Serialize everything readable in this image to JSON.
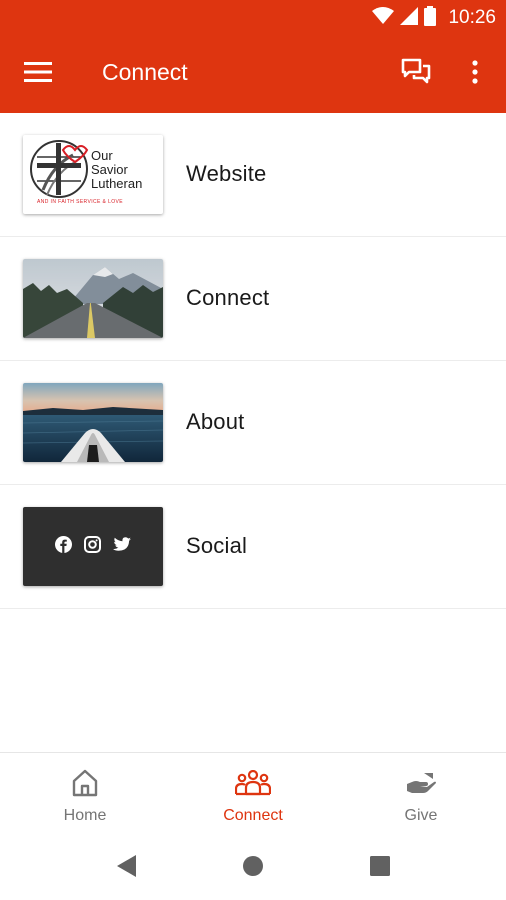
{
  "status_bar": {
    "time": "10:26"
  },
  "app_bar": {
    "title": "Connect",
    "menu_icon": "menu-icon",
    "chat_icon": "chat-icon",
    "more_icon": "more-vert-icon"
  },
  "list": {
    "items": [
      {
        "label": "Website",
        "thumb": {
          "logo_line1": "Our",
          "logo_line2": "Savior",
          "logo_line3": "Lutheran",
          "tagline": "AND IN FAITH SERVICE & LOVE"
        }
      },
      {
        "label": "Connect",
        "thumb": "mountain-road-photo"
      },
      {
        "label": "About",
        "thumb": "kayak-lake-photo"
      },
      {
        "label": "Social",
        "thumb": "social-icons-tile"
      }
    ]
  },
  "bottom_nav": {
    "tabs": [
      {
        "label": "Home",
        "icon": "home-icon",
        "active": false
      },
      {
        "label": "Connect",
        "icon": "people-icon",
        "active": true
      },
      {
        "label": "Give",
        "icon": "give-icon",
        "active": false
      }
    ]
  },
  "colors": {
    "primary": "#de3510",
    "inactive": "#757575",
    "text": "#1a1a1a",
    "social_tile": "#2f2f2f"
  }
}
